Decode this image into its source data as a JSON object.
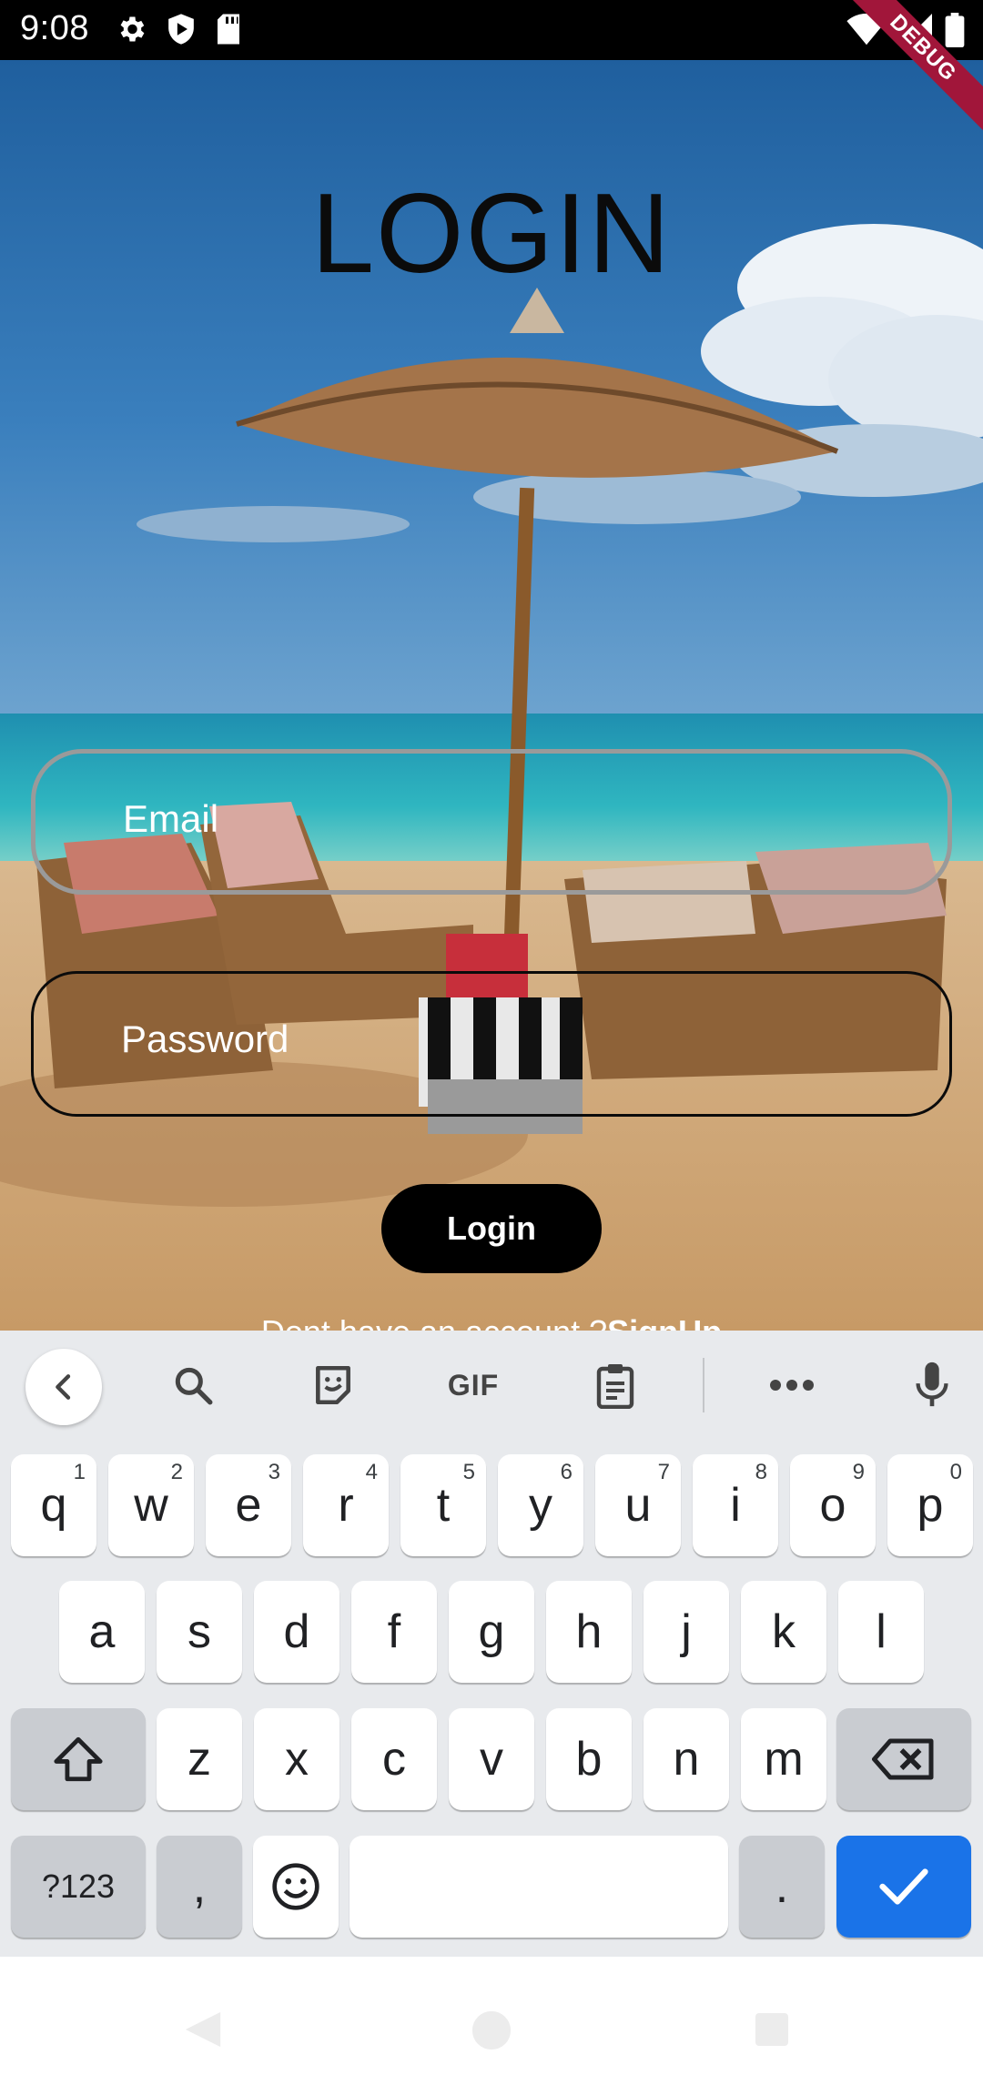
{
  "status_bar": {
    "time": "9:08",
    "left_icons": [
      "gear-icon",
      "play-protect-icon",
      "sd-card-icon"
    ],
    "right_icons": [
      "wifi-icon",
      "signal-icon",
      "battery-icon"
    ],
    "debug_banner": "DEBUG"
  },
  "login": {
    "title": "LOGIN",
    "email_label": "Email",
    "password_label": "Password",
    "login_button": "Login",
    "signup_prompt": "Dont have an account ?",
    "signup_link": "SignUp"
  },
  "keyboard": {
    "toolbar": [
      "back-icon",
      "search-icon",
      "sticker-icon",
      "GIF",
      "clipboard-icon",
      "more-icon",
      "mic-icon"
    ],
    "row1": [
      {
        "k": "q",
        "h": "1"
      },
      {
        "k": "w",
        "h": "2"
      },
      {
        "k": "e",
        "h": "3"
      },
      {
        "k": "r",
        "h": "4"
      },
      {
        "k": "t",
        "h": "5"
      },
      {
        "k": "y",
        "h": "6"
      },
      {
        "k": "u",
        "h": "7"
      },
      {
        "k": "i",
        "h": "8"
      },
      {
        "k": "o",
        "h": "9"
      },
      {
        "k": "p",
        "h": "0"
      }
    ],
    "row2": [
      "a",
      "s",
      "d",
      "f",
      "g",
      "h",
      "j",
      "k",
      "l"
    ],
    "row3": [
      "z",
      "x",
      "c",
      "v",
      "b",
      "n",
      "m"
    ],
    "symbols_key": "?123",
    "comma_key": ",",
    "period_key": ".",
    "enter_color": "#1a73e8"
  },
  "colors": {
    "login_button_bg": "#000000",
    "debug_ribbon": "#a1163a",
    "keyboard_bg": "#e8eaed"
  }
}
